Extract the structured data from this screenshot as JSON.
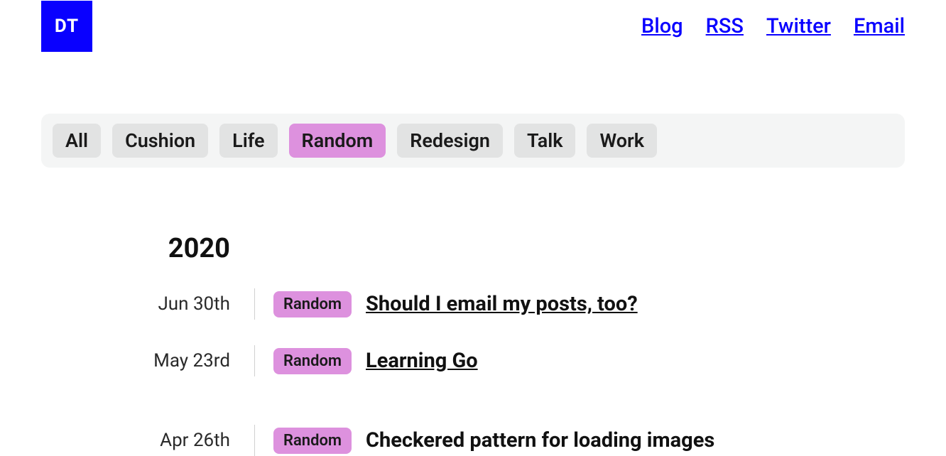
{
  "logo": "DT",
  "nav": {
    "blog": "Blog",
    "rss": "RSS",
    "twitter": "Twitter",
    "email": "Email"
  },
  "tags": {
    "all": "All",
    "cushion": "Cushion",
    "life": "Life",
    "random": "Random",
    "redesign": "Redesign",
    "talk": "Talk",
    "work": "Work"
  },
  "year": "2020",
  "posts": [
    {
      "date": "Jun 30th",
      "tag": "Random",
      "title": "Should I email my posts, too?"
    },
    {
      "date": "May 23rd",
      "tag": "Random",
      "title": "Learning Go"
    },
    {
      "date": "Apr 26th",
      "tag": "Random",
      "title": "Checkered pattern for loading images"
    }
  ]
}
